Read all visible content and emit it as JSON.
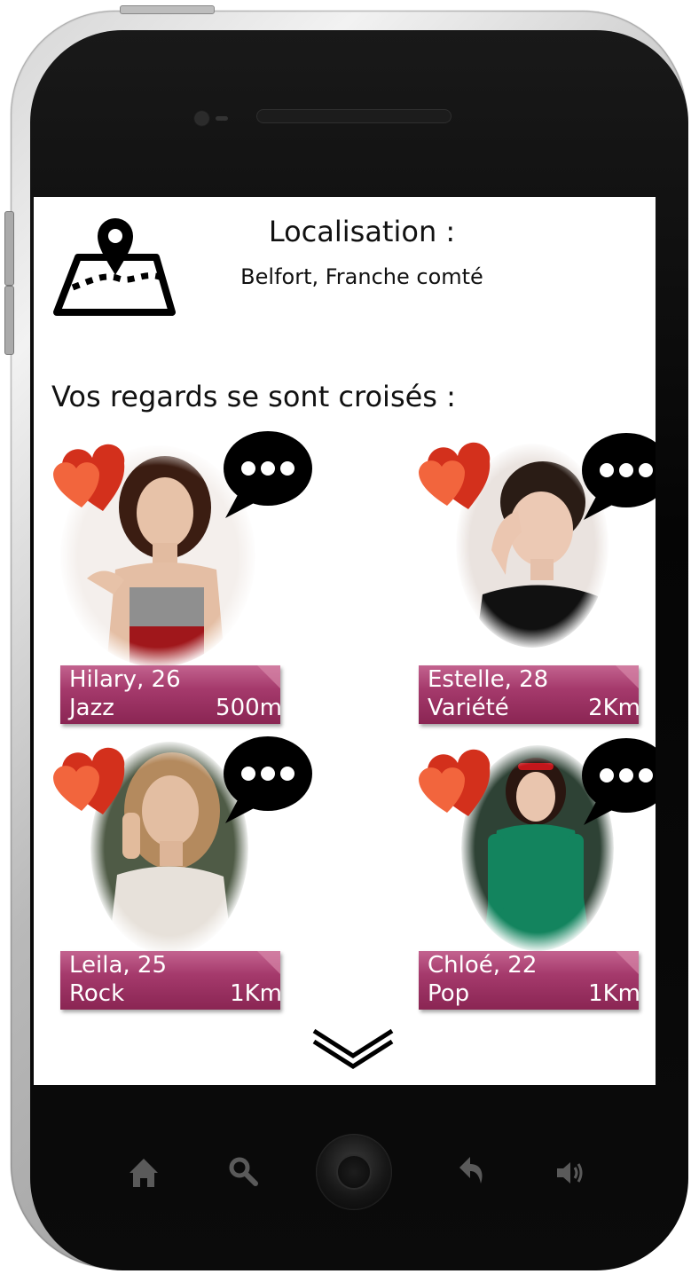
{
  "location": {
    "title": "Localisation :",
    "value": "Belfort, Franche comté",
    "icon": "map-pin-icon"
  },
  "section": {
    "title": "Vos regards se sont croisés :"
  },
  "profiles": [
    {
      "name": "Hilary, 26",
      "genre": "Jazz",
      "distance": "500m"
    },
    {
      "name": "Estelle, 28",
      "genre": "Variété",
      "distance": "2Km"
    },
    {
      "name": "Leila, 25",
      "genre": "Rock",
      "distance": "1Km"
    },
    {
      "name": "Chloé, 22",
      "genre": "Pop",
      "distance": "1Km"
    }
  ],
  "colors": {
    "badge": "#a53a6c",
    "heart_dark": "#d3301c",
    "heart_light": "#f2653d",
    "bubble": "#000000"
  },
  "icons": {
    "like": "hearts-icon",
    "chat": "chat-bubble-icon",
    "more": "chevron-down-icon",
    "nav": [
      "home-icon",
      "search-icon",
      "back-icon",
      "volume-icon"
    ]
  }
}
